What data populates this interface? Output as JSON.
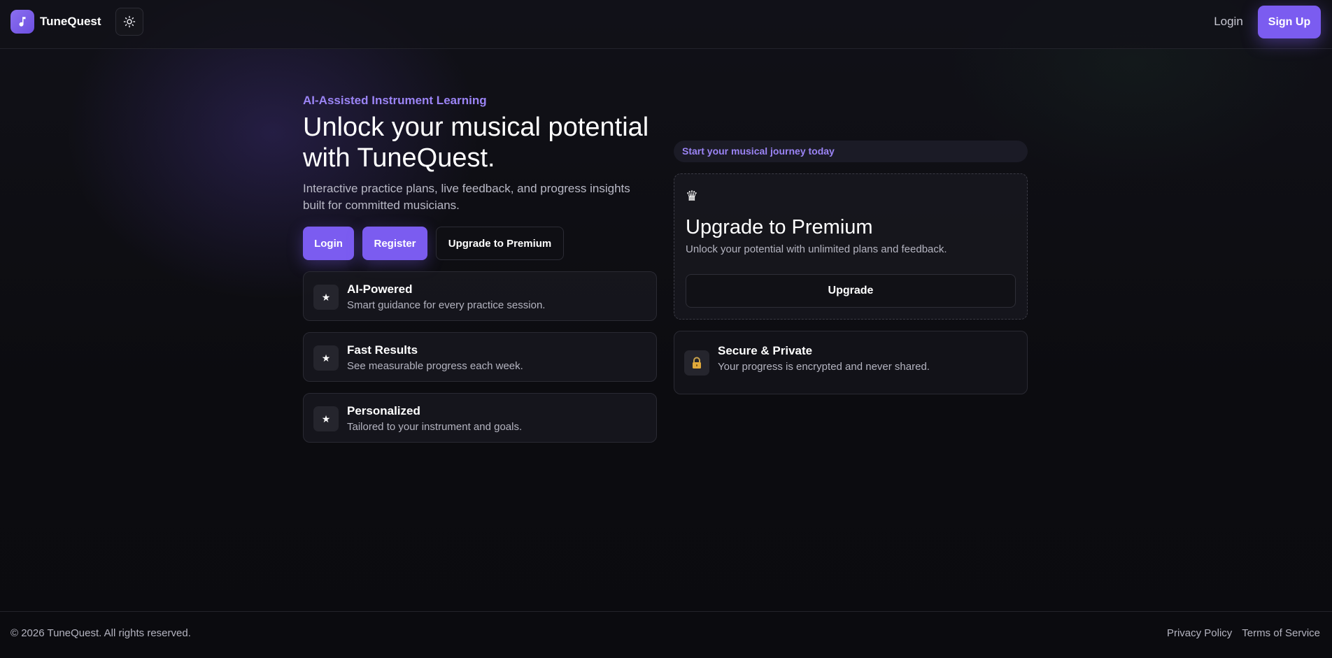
{
  "header": {
    "brand": "TuneQuest",
    "logo_icon": "music-note-icon",
    "theme_icon": "sun-icon",
    "login_label": "Login",
    "signup_label": "Sign Up"
  },
  "hero": {
    "eyebrow": "AI-Assisted Instrument Learning",
    "title": "Unlock your musical potential with TuneQuest.",
    "subtitle": "Interactive practice plans, live feedback, and progress insights built for committed musicians.",
    "buttons": {
      "login": "Login",
      "register": "Register",
      "upgrade": "Upgrade to Premium"
    }
  },
  "features": [
    {
      "icon": "★",
      "title": "AI-Powered",
      "description": "Smart guidance for every practice session."
    },
    {
      "icon": "★",
      "title": "Fast Results",
      "description": "See measurable progress each week."
    },
    {
      "icon": "★",
      "title": "Personalized",
      "description": "Tailored to your instrument and goals."
    }
  ],
  "sidebar": {
    "journey_label": "Start your musical journey today",
    "premium": {
      "icon": "♛",
      "title": "Upgrade to Premium",
      "description": "Unlock your potential with unlimited plans and feedback.",
      "button_label": "Upgrade"
    },
    "secure": {
      "icon": "lock-icon",
      "title": "Secure & Private",
      "description": "Your progress is encrypted and never shared."
    }
  },
  "footer": {
    "copyright": "© 2026 TuneQuest. All rights reserved.",
    "links": [
      "Privacy Policy",
      "Terms of Service"
    ]
  },
  "colors": {
    "accent": "#7b5cf0",
    "accent_text": "#9b84f5",
    "background": "#0c0c10"
  }
}
